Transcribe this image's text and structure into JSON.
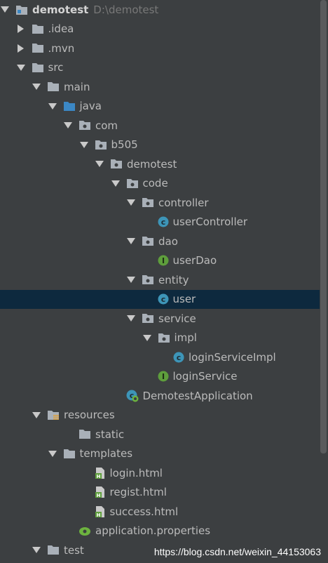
{
  "project": {
    "name": "demotest",
    "path": "D:\\demotest"
  },
  "items": [
    {
      "label": ".idea",
      "arrow": "right",
      "icon": "folder-icon",
      "depth": 1
    },
    {
      "label": ".mvn",
      "arrow": "right",
      "icon": "folder-icon",
      "depth": 1
    },
    {
      "label": "src",
      "arrow": "down",
      "icon": "folder-icon",
      "depth": 1
    },
    {
      "label": "main",
      "arrow": "down",
      "icon": "folder-icon",
      "depth": 2
    },
    {
      "label": "java",
      "arrow": "down",
      "icon": "source-folder-icon",
      "depth": 3
    },
    {
      "label": "com",
      "arrow": "down",
      "icon": "package-icon",
      "depth": 4
    },
    {
      "label": "b505",
      "arrow": "down",
      "icon": "package-icon",
      "depth": 5
    },
    {
      "label": "demotest",
      "arrow": "down",
      "icon": "package-icon",
      "depth": 6
    },
    {
      "label": "code",
      "arrow": "down",
      "icon": "package-icon",
      "depth": 7
    },
    {
      "label": "controller",
      "arrow": "down",
      "icon": "package-icon",
      "depth": 8
    },
    {
      "label": "userController",
      "arrow": "none",
      "icon": "class-icon",
      "depth": 9
    },
    {
      "label": "dao",
      "arrow": "down",
      "icon": "package-icon",
      "depth": 8
    },
    {
      "label": "userDao",
      "arrow": "none",
      "icon": "interface-icon",
      "depth": 9
    },
    {
      "label": "entity",
      "arrow": "down",
      "icon": "package-icon",
      "depth": 8
    },
    {
      "label": "user",
      "arrow": "none",
      "icon": "class-icon",
      "depth": 9,
      "selected": true
    },
    {
      "label": "service",
      "arrow": "down",
      "icon": "package-icon",
      "depth": 8
    },
    {
      "label": "impl",
      "arrow": "down",
      "icon": "package-icon",
      "depth": 9
    },
    {
      "label": "loginServiceImpl",
      "arrow": "none",
      "icon": "class-icon",
      "depth": 10
    },
    {
      "label": "loginService",
      "arrow": "none",
      "icon": "interface-icon",
      "depth": 9
    },
    {
      "label": "DemotestApplication",
      "arrow": "none",
      "icon": "spring-boot-class-icon",
      "depth": 7
    },
    {
      "label": "resources",
      "arrow": "down",
      "icon": "resources-folder-icon",
      "depth": 2
    },
    {
      "label": "static",
      "arrow": "none",
      "icon": "folder-icon",
      "depth": 4
    },
    {
      "label": "templates",
      "arrow": "down",
      "icon": "folder-icon",
      "depth": 3
    },
    {
      "label": "login.html",
      "arrow": "none",
      "icon": "html-file-icon",
      "depth": 5
    },
    {
      "label": "regist.html",
      "arrow": "none",
      "icon": "html-file-icon",
      "depth": 5
    },
    {
      "label": "success.html",
      "arrow": "none",
      "icon": "html-file-icon",
      "depth": 5
    },
    {
      "label": "application.properties",
      "arrow": "none",
      "icon": "properties-file-icon",
      "depth": 4
    },
    {
      "label": "test",
      "arrow": "down",
      "icon": "folder-icon",
      "depth": 2
    }
  ],
  "watermark": "https://blog.csdn.net/weixin_44153063",
  "colors": {
    "background": "#3c3f41",
    "selection": "#0d293e",
    "folder": "#a9b0b8",
    "source_folder": "#3b87c4",
    "class_badge": "#3d95b8",
    "interface_badge": "#5e9e3c"
  }
}
